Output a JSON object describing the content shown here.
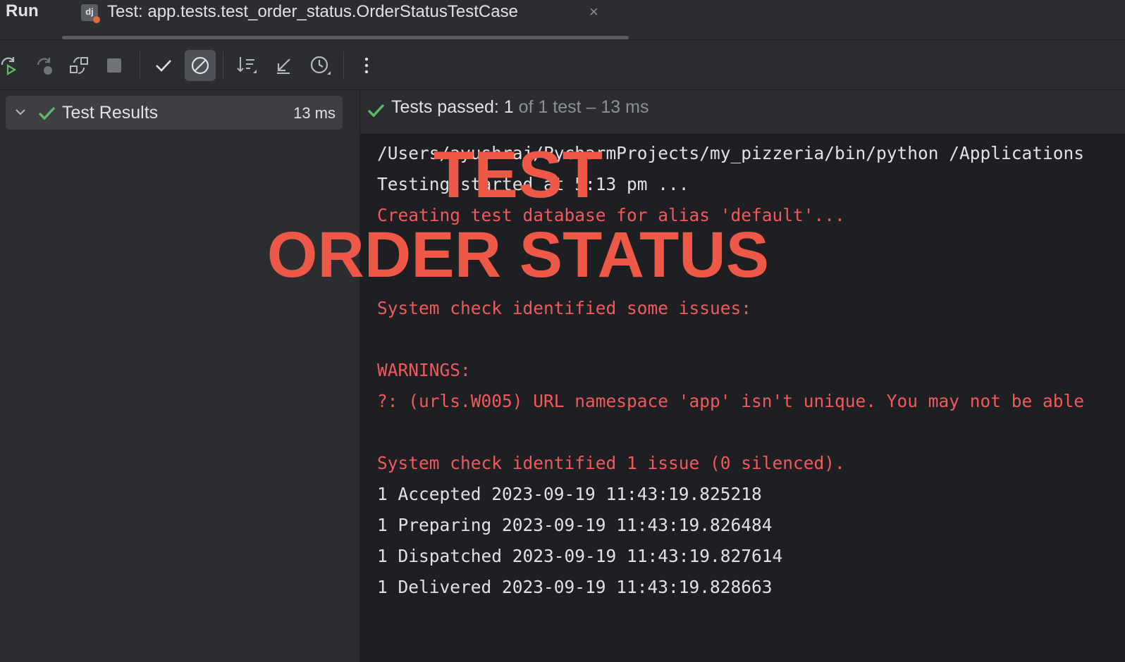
{
  "tabbar": {
    "run_label": "Run",
    "tab_icon_text": "dj",
    "tab_title": "Test: app.tests.test_order_status.OrderStatusTestCase",
    "tab_close": "×"
  },
  "toolbar": {
    "icons": [
      "rerun-icon",
      "rerun-failed-icon",
      "toggle-autotest-icon",
      "stop-icon",
      "show-passed-icon",
      "show-ignored-icon",
      "sort-icon",
      "collapse-icon",
      "history-icon",
      "more-icon"
    ]
  },
  "tree": {
    "root_label": "Test Results",
    "root_time": "13 ms"
  },
  "status": {
    "passed_label": "Tests passed: 1",
    "of_label": " of 1 test – 13 ms"
  },
  "console": {
    "lines": [
      {
        "text": "/Users/ayushraj/PycharmProjects/my_pizzeria/bin/python /Applications",
        "kind": "out"
      },
      {
        "text": "Testing started at 5:13 pm ...",
        "kind": "out"
      },
      {
        "text": "Creating test database for alias 'default'...",
        "kind": "err"
      },
      {
        "text": "",
        "kind": "err"
      },
      {
        "text": "",
        "kind": "err"
      },
      {
        "text": "System check identified some issues:",
        "kind": "err"
      },
      {
        "text": "",
        "kind": "err"
      },
      {
        "text": "WARNINGS:",
        "kind": "err"
      },
      {
        "text": "?: (urls.W005) URL namespace 'app' isn't unique. You may not be able",
        "kind": "err"
      },
      {
        "text": "",
        "kind": "err"
      },
      {
        "text": "System check identified 1 issue (0 silenced).",
        "kind": "err"
      },
      {
        "text": "1 Accepted 2023-09-19 11:43:19.825218",
        "kind": "out"
      },
      {
        "text": "1 Preparing 2023-09-19 11:43:19.826484",
        "kind": "out"
      },
      {
        "text": "1 Dispatched 2023-09-19 11:43:19.827614",
        "kind": "out"
      },
      {
        "text": "1 Delivered 2023-09-19 11:43:19.828663",
        "kind": "out"
      }
    ]
  },
  "overlay": {
    "line1": "TEST",
    "line2": "ORDER STATUS"
  },
  "colors": {
    "passed": "#5fb865",
    "error": "#f05a5a",
    "overlay": "#ee5847"
  }
}
